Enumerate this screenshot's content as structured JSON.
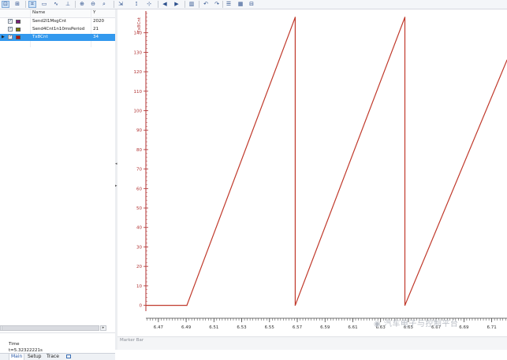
{
  "toolbar": {
    "buttons": [
      {
        "name": "zoom-fit-icon",
        "glyph": "⊡"
      },
      {
        "name": "zoom-x-icon",
        "glyph": "⊞"
      },
      {
        "name": "cursor-mode-icon",
        "glyph": "⌗"
      },
      {
        "name": "marker-icon",
        "glyph": "▭"
      },
      {
        "name": "signal-style-icon",
        "glyph": "∿"
      },
      {
        "name": "trigger-icon",
        "glyph": "⊥"
      },
      {
        "name": "zoom-in-icon",
        "glyph": "⊕"
      },
      {
        "name": "zoom-out-icon",
        "glyph": "⊖"
      },
      {
        "name": "zoom-box-icon",
        "glyph": "⌕"
      },
      {
        "name": "scale-icon",
        "glyph": "⇲"
      },
      {
        "name": "measure-icon",
        "glyph": "⟟"
      },
      {
        "name": "axis-icon",
        "glyph": "⊹"
      },
      {
        "name": "step-back-icon",
        "glyph": "◀"
      },
      {
        "name": "step-forward-icon",
        "glyph": "▶"
      },
      {
        "name": "layout-icon",
        "glyph": "▥"
      },
      {
        "name": "undo-icon",
        "glyph": "↶"
      },
      {
        "name": "redo-icon",
        "glyph": "↷"
      },
      {
        "name": "list-icon",
        "glyph": "☰"
      },
      {
        "name": "save-icon",
        "glyph": "▦"
      },
      {
        "name": "export-icon",
        "glyph": "⊟"
      }
    ]
  },
  "grid": {
    "name_header": "Name",
    "value_header": "Y",
    "rows": [
      {
        "name": "Send2I1MsgCnt",
        "value": "2020",
        "color": "#7a1e7a",
        "checked": true,
        "selected": false
      },
      {
        "name": "Send4Cnt1n10msPeriod",
        "value": "21",
        "color": "#7d7a00",
        "checked": true,
        "selected": false
      },
      {
        "name": "Tx8Cnt",
        "value": "34",
        "color": "#b01010",
        "checked": true,
        "selected": true
      }
    ]
  },
  "time_panel": {
    "label": "Time",
    "value": "t=5.32322221s"
  },
  "tabs": [
    {
      "label": "Main",
      "active": true
    },
    {
      "label": "Setup",
      "active": false
    },
    {
      "label": "Trace",
      "active": false
    }
  ],
  "marker_bar": {
    "label": "Marker Bar"
  },
  "watermark": {
    "text": "汽车电子与控制平台"
  },
  "chart_data": {
    "type": "line",
    "ylabel": "Tx8Cnt",
    "yticks": [
      0,
      10,
      20,
      30,
      40,
      50,
      60,
      70,
      80,
      90,
      100,
      110,
      120,
      130,
      140
    ],
    "ylim": [
      -3,
      152
    ],
    "xticks": [
      "6.47",
      "6.49",
      "6.51",
      "6.53",
      "6.55",
      "6.57",
      "6.59",
      "6.61",
      "6.63",
      "6.65",
      "6.67",
      "6.69",
      "6.71"
    ],
    "xtick_values": [
      6.47,
      6.49,
      6.51,
      6.53,
      6.55,
      6.57,
      6.59,
      6.61,
      6.63,
      6.65,
      6.67,
      6.69,
      6.71
    ],
    "xlim": [
      6.461,
      6.721
    ],
    "grid": false,
    "series": [
      {
        "name": "Tx8Cnt",
        "color": "#c0392b",
        "x": [
          6.461,
          6.4905,
          6.5685,
          6.5685,
          6.6475,
          6.6475,
          6.721
        ],
        "y": [
          0,
          0,
          148,
          0,
          148,
          0,
          126
        ]
      }
    ]
  }
}
